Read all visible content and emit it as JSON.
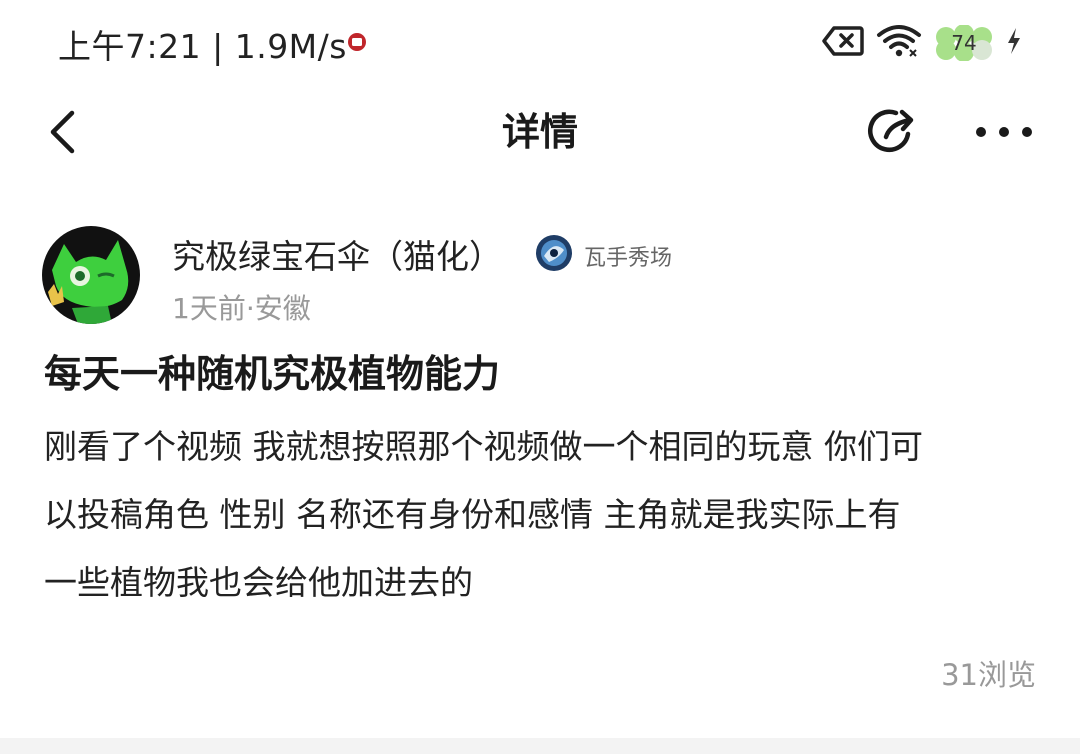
{
  "status_bar": {
    "time_speed": "上午7:21 | 1.9M/s",
    "battery": "74"
  },
  "header": {
    "title": "详情"
  },
  "post": {
    "author_name": "究极绿宝石伞（猫化）",
    "badge": "瓦手秀场",
    "meta": "1天前·安徽",
    "title": "每天一种随机究极植物能力",
    "body_lines": [
      "刚看了个视频 我就想按照那个视频做一个相同的玩意 你们可",
      "以投稿角色 性别 名称还有身份和感情 主角就是我实际上有",
      "一些植物我也会给他加进去的"
    ],
    "views": "31浏览"
  },
  "colors": {
    "text_primary": "#1a1a1a",
    "text_secondary": "#999999",
    "battery_fill": "#a8e08a",
    "avatar_bg": "#111111",
    "avatar_green": "#3ecf3e"
  }
}
